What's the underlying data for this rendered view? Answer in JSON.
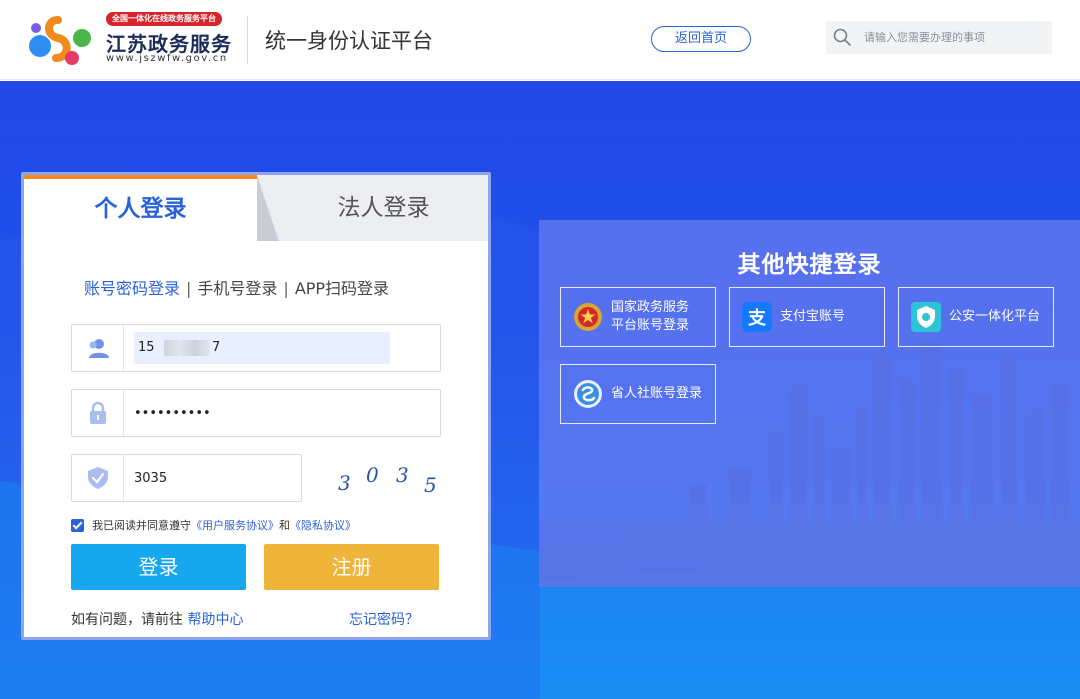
{
  "header": {
    "brand_badge": "全国一体化在线政务服务平台",
    "brand_name": "江苏政务服务",
    "brand_url": "www.jszwfw.gov.cn",
    "platform_title": "统一身份认证平台",
    "home_button": "返回首页",
    "search": {
      "placeholder": "请输入您需要办理的事项",
      "icon": "search-icon"
    }
  },
  "login": {
    "tabs": [
      {
        "label": "个人登录",
        "active": true
      },
      {
        "label": "法人登录",
        "active": false
      }
    ],
    "methods": [
      {
        "label": "账号密码登录",
        "active": true
      },
      {
        "label": "手机号登录",
        "active": false
      },
      {
        "label": "APP扫码登录",
        "active": false
      }
    ],
    "method_separator": "|",
    "username": {
      "prefix": "15",
      "suffix": "7",
      "icon": "user-icon"
    },
    "password": {
      "value": "••••••••••",
      "icon": "lock-icon"
    },
    "captcha": {
      "value": "3035",
      "image_digits": [
        "3",
        "0",
        "3",
        "5"
      ],
      "icon": "shield-icon"
    },
    "agreement": {
      "checked": true,
      "prefix": "我已阅读并同意遵守",
      "link1": "《用户服务协议》",
      "conjunction": "和",
      "link2": "《隐私协议》"
    },
    "login_button": "登录",
    "register_button": "注册",
    "help_prefix": "如有问题，请前往",
    "help_link": "帮助中心",
    "forgot_link": "忘记密码？"
  },
  "quick_login": {
    "title": "其他快捷登录",
    "options": [
      {
        "label": "国家政务服务\n平台账号登录",
        "icon": "national-emblem-icon"
      },
      {
        "label": "支付宝账号",
        "icon": "alipay-icon"
      },
      {
        "label": "公安一体化平台",
        "icon": "police-badge-icon"
      },
      {
        "label": "省人社账号登录",
        "icon": "social-security-icon"
      }
    ]
  },
  "colors": {
    "primary": "#2a62d8",
    "tab_accent": "#f58a1f",
    "login_button": "#17a7ef",
    "register_button": "#efb43a",
    "badge": "#d7262b"
  }
}
